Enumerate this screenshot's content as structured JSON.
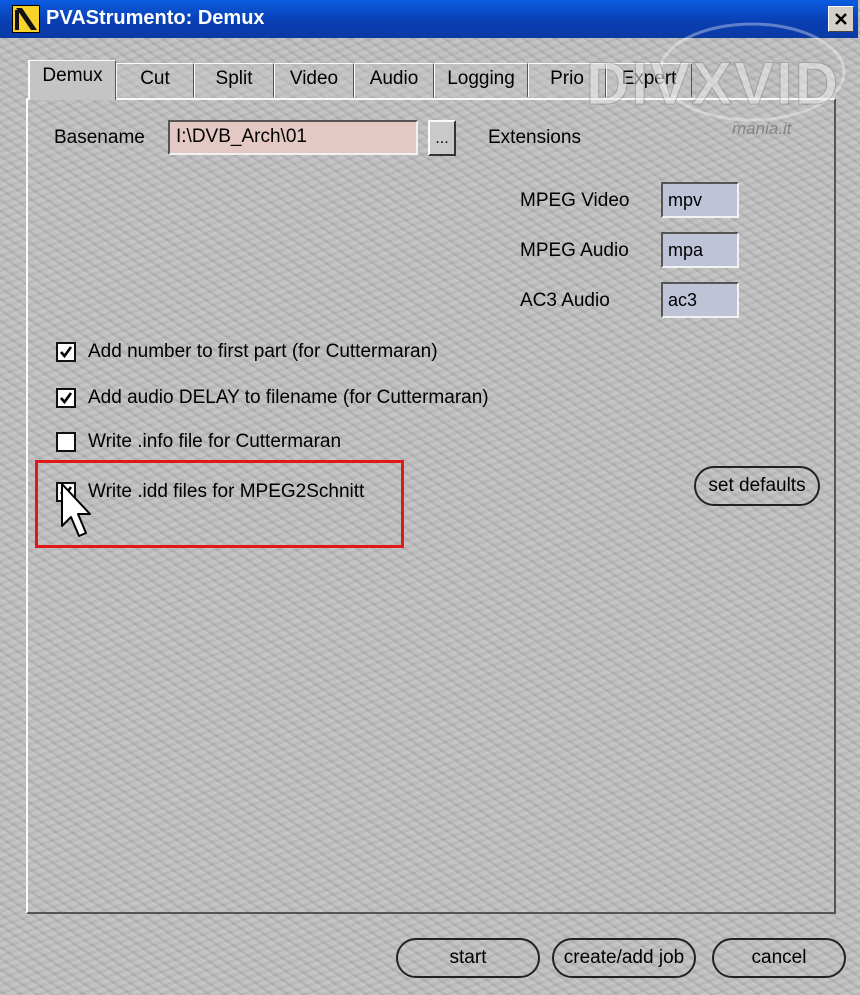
{
  "window": {
    "title": "PVAStrumento: Demux",
    "close_glyph": "✕"
  },
  "tabs": [
    {
      "label": "Demux",
      "active": true
    },
    {
      "label": "Cut",
      "active": false
    },
    {
      "label": "Split",
      "active": false
    },
    {
      "label": "Video",
      "active": false
    },
    {
      "label": "Audio",
      "active": false
    },
    {
      "label": "Logging",
      "active": false
    },
    {
      "label": "Prio",
      "active": false
    },
    {
      "label": "Expert",
      "active": false
    }
  ],
  "demux": {
    "basename_label": "Basename",
    "basename_value": "I:\\DVB_Arch\\01",
    "browse_label": "...",
    "extensions_label": "Extensions",
    "extensions": [
      {
        "label": "MPEG Video",
        "value": "mpv"
      },
      {
        "label": "MPEG Audio",
        "value": "mpa"
      },
      {
        "label": "AC3 Audio",
        "value": "ac3"
      }
    ],
    "options": [
      {
        "label": "Add number to first part (for Cuttermaran)",
        "checked": true
      },
      {
        "label": "Add audio DELAY to filename (for Cuttermaran)",
        "checked": true
      },
      {
        "label": "Write .info file for Cuttermaran",
        "checked": false
      },
      {
        "label": "Write .idd files for MPEG2Schnitt",
        "checked": true
      }
    ],
    "set_defaults_label": "set defaults"
  },
  "footer": {
    "start_label": "start",
    "create_job_label": "create/add job",
    "cancel_label": "cancel"
  },
  "watermark": {
    "line1": "DIVXVID",
    "line2": "mania.it"
  },
  "colors": {
    "title_bar": "#0a4cc8",
    "basename_bg": "#e4c8c3",
    "extension_bg": "#bfc3d8",
    "highlight": "#e01818"
  }
}
